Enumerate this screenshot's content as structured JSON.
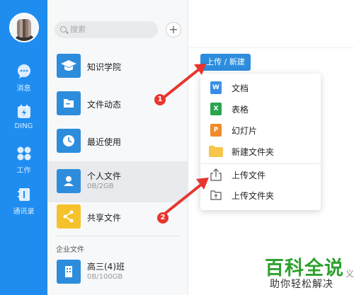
{
  "sidebar": {
    "items": [
      {
        "label": "消息",
        "icon": "chat-icon"
      },
      {
        "label": "DING",
        "icon": "ding-icon"
      },
      {
        "label": "工作",
        "icon": "apps-grid-icon"
      },
      {
        "label": "通讯录",
        "icon": "contacts-icon"
      }
    ]
  },
  "panel": {
    "search_placeholder": "搜索",
    "plus": "+",
    "items": [
      {
        "name": "知识学院",
        "sub": "",
        "icon": "graduation-cap-icon",
        "color": "#2d8ddc"
      },
      {
        "name": "文件动态",
        "sub": "",
        "icon": "folder-icon",
        "color": "#2d8ddc"
      },
      {
        "name": "最近使用",
        "sub": "",
        "icon": "clock-icon",
        "color": "#2d8ddc"
      },
      {
        "name": "个人文件",
        "sub": "0B/2GB",
        "icon": "person-icon",
        "color": "#2d8ddc"
      },
      {
        "name": "共享文件",
        "sub": "",
        "icon": "share-icon",
        "color": "#f5c22b"
      },
      {
        "name": "高三(4)班",
        "sub": "0B/100GB",
        "icon": "building-icon",
        "color": "#2d8ddc"
      }
    ],
    "section_label": "企业文件"
  },
  "main": {
    "upload_button": "上传 / 新建",
    "menu": [
      {
        "label": "文档",
        "icon": "doc-icon",
        "glyph": "W",
        "color": "#3a8ee6"
      },
      {
        "label": "表格",
        "icon": "sheet-icon",
        "glyph": "X",
        "color": "#2aa44f"
      },
      {
        "label": "幻灯片",
        "icon": "slides-icon",
        "glyph": "P",
        "color": "#f08a2a"
      },
      {
        "label": "新建文件夹",
        "icon": "folder-icon",
        "glyph": "",
        "color": "#f6c64a"
      },
      {
        "label": "上传文件",
        "icon": "upload-file-icon",
        "glyph": "",
        "color": "#555555"
      },
      {
        "label": "上传文件夹",
        "icon": "upload-folder-icon",
        "glyph": "",
        "color": "#555555"
      }
    ]
  },
  "annotations": {
    "badge1": "1",
    "badge2": "2",
    "arrow_color": "#e8352d"
  },
  "watermark": {
    "title": "百科全说",
    "subtitle": "助你轻松解决",
    "edge": "义"
  }
}
